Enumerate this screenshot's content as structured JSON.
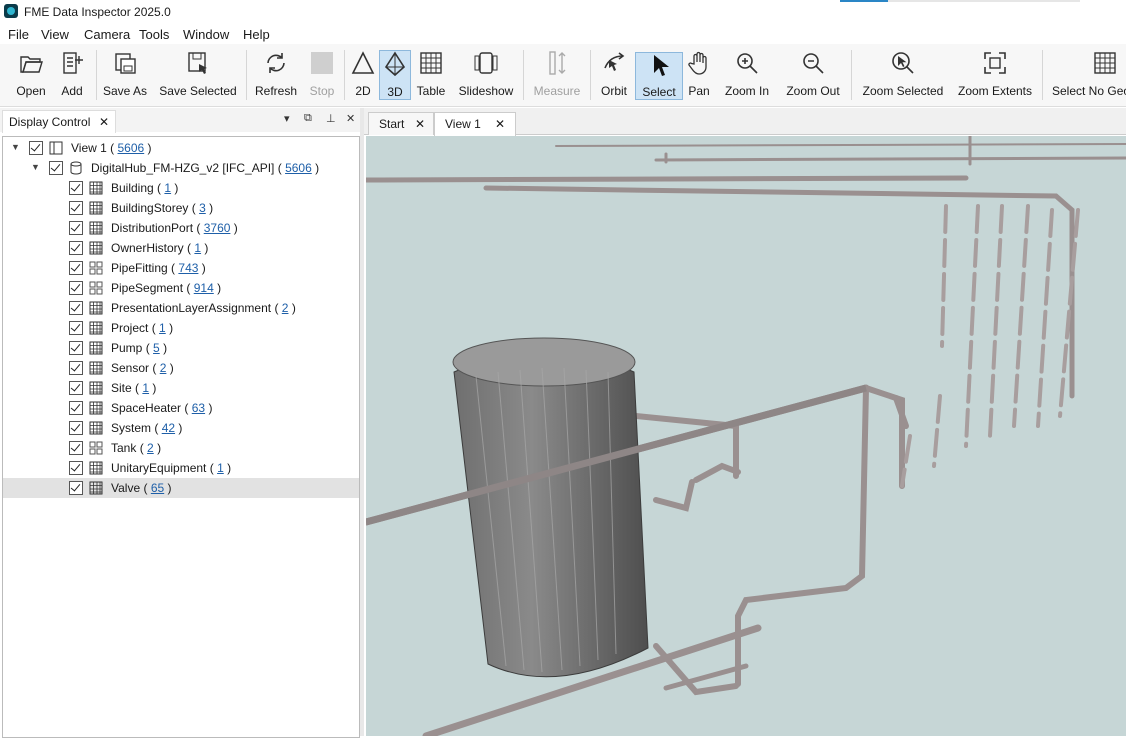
{
  "window": {
    "title": "FME Data Inspector 2025.0"
  },
  "menu": [
    "File",
    "View",
    "Camera",
    "Tools",
    "Window",
    "Help"
  ],
  "toolbar": {
    "open": "Open",
    "add": "Add",
    "save_as": "Save As",
    "save_selected": "Save Selected",
    "refresh": "Refresh",
    "stop": "Stop",
    "mode_2d": "2D",
    "mode_3d": "3D",
    "table": "Table",
    "slideshow": "Slideshow",
    "measure": "Measure",
    "orbit": "Orbit",
    "select": "Select",
    "pan": "Pan",
    "zoom_in": "Zoom In",
    "zoom_out": "Zoom Out",
    "zoom_selected": "Zoom Selected",
    "zoom_extents": "Zoom Extents",
    "select_no_geom": "Select No Geo"
  },
  "display_control": {
    "title": "Display Control",
    "close_glyph": "✕",
    "controls": {
      "dropdown": "▾",
      "float": "⧉",
      "pin": "⊥",
      "close": "✕"
    },
    "view": {
      "name": "View 1",
      "count": "5606"
    },
    "dataset": {
      "name": "DigitalHub_FM-HZG_v2 [IFC_API]",
      "count": "5606"
    },
    "layers": [
      {
        "name": "Building",
        "count": "1"
      },
      {
        "name": "BuildingStorey",
        "count": "3"
      },
      {
        "name": "DistributionPort",
        "count": "3760"
      },
      {
        "name": "OwnerHistory",
        "count": "1"
      },
      {
        "name": "PipeFitting",
        "count": "743"
      },
      {
        "name": "PipeSegment",
        "count": "914"
      },
      {
        "name": "PresentationLayerAssignment",
        "count": "2"
      },
      {
        "name": "Project",
        "count": "1"
      },
      {
        "name": "Pump",
        "count": "5"
      },
      {
        "name": "Sensor",
        "count": "2"
      },
      {
        "name": "Site",
        "count": "1"
      },
      {
        "name": "SpaceHeater",
        "count": "63"
      },
      {
        "name": "System",
        "count": "42"
      },
      {
        "name": "Tank",
        "count": "2"
      },
      {
        "name": "UnitaryEquipment",
        "count": "1"
      },
      {
        "name": "Valve",
        "count": "65"
      }
    ],
    "paren_open": "(",
    "paren_close": ")"
  },
  "view_tabs": {
    "start": "Start",
    "view1": "View 1",
    "close_glyph": "✕"
  },
  "colors": {
    "accent": "#2a86c6",
    "viewport_bg": "#c6d6d6",
    "link": "#1e5fa8",
    "selected_tool": "#cde3f5"
  }
}
